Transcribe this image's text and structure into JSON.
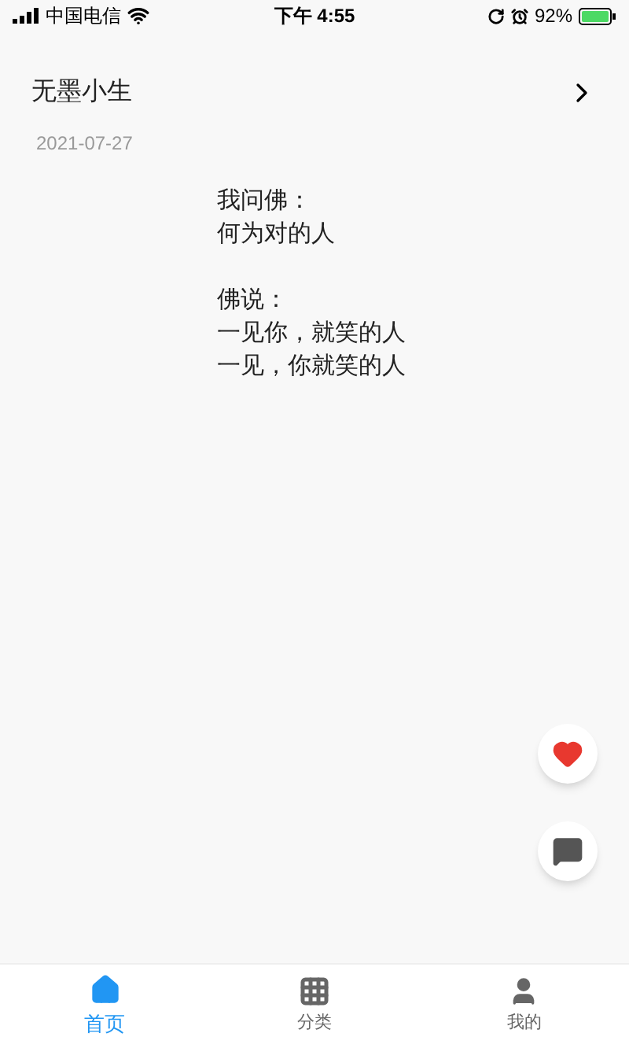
{
  "status_bar": {
    "carrier": "中国电信",
    "time": "下午 4:55",
    "battery": "92%"
  },
  "post": {
    "author": "无墨小生",
    "date": "2021-07-27",
    "stanzas": [
      [
        "我问佛：",
        "何为对的人"
      ],
      [
        "佛说：",
        "一见你，就笑的人",
        "一见，你就笑的人"
      ]
    ]
  },
  "actions": [
    {
      "kind": "like",
      "active": true
    },
    {
      "kind": "comment",
      "active": false
    }
  ],
  "tabs": [
    {
      "kind": "home",
      "label": "首页",
      "selected": true
    },
    {
      "kind": "category",
      "label": "分类",
      "selected": false
    },
    {
      "kind": "profile",
      "label": "我的",
      "selected": false
    }
  ]
}
